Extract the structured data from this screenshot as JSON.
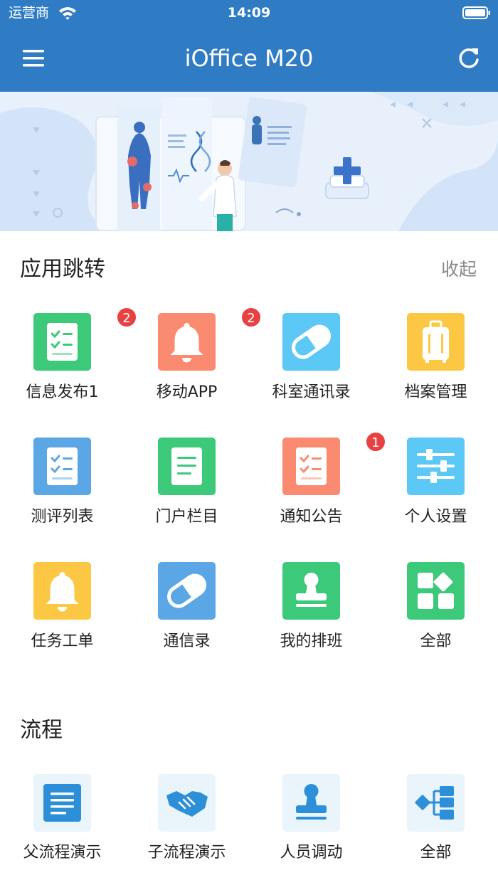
{
  "status_bar": {
    "carrier": "运营商",
    "time": "14:09"
  },
  "nav": {
    "title": "iOffice M20",
    "menu_icon": "hamburger-menu-icon",
    "refresh_icon": "refresh-icon"
  },
  "apps_section": {
    "title": "应用跳转",
    "collapse_label": "收起",
    "items": [
      {
        "label": "信息发布1",
        "icon": "checklist-icon",
        "color": "#3cc97a",
        "badge": "2"
      },
      {
        "label": "移动APP",
        "icon": "bell-icon",
        "color": "#fa8a70",
        "badge": "2"
      },
      {
        "label": "科室通讯录",
        "icon": "pill-icon",
        "color": "#5bc8f5",
        "badge": ""
      },
      {
        "label": "档案管理",
        "icon": "suitcase-icon",
        "color": "#fcc844",
        "badge": ""
      },
      {
        "label": "测评列表",
        "icon": "checklist-icon",
        "color": "#5ba7e6",
        "badge": ""
      },
      {
        "label": "门户栏目",
        "icon": "document-icon",
        "color": "#3cc97a",
        "badge": ""
      },
      {
        "label": "通知公告",
        "icon": "checklist-icon",
        "color": "#fa8a70",
        "badge": "1"
      },
      {
        "label": "个人设置",
        "icon": "sliders-icon",
        "color": "#5bc8f5",
        "badge": ""
      },
      {
        "label": "任务工单",
        "icon": "bell-icon",
        "color": "#fcc844",
        "badge": ""
      },
      {
        "label": "通信录",
        "icon": "pill-icon",
        "color": "#5ba7e6",
        "badge": ""
      },
      {
        "label": "我的排班",
        "icon": "stamp-icon",
        "color": "#3cc97a",
        "badge": ""
      },
      {
        "label": "全部",
        "icon": "grid-icon",
        "color": "#3cc97a",
        "badge": ""
      }
    ]
  },
  "flow_section": {
    "title": "流程",
    "items": [
      {
        "label": "父流程演示",
        "icon": "document-icon"
      },
      {
        "label": "子流程演示",
        "icon": "handshake-icon"
      },
      {
        "label": "人员调动",
        "icon": "stamp-icon"
      },
      {
        "label": "全部",
        "icon": "flowchart-icon"
      }
    ]
  },
  "colors": {
    "header_bg": "#2f7cc4",
    "flow_icon": "#2d8fd8",
    "badge": "#e84141"
  }
}
